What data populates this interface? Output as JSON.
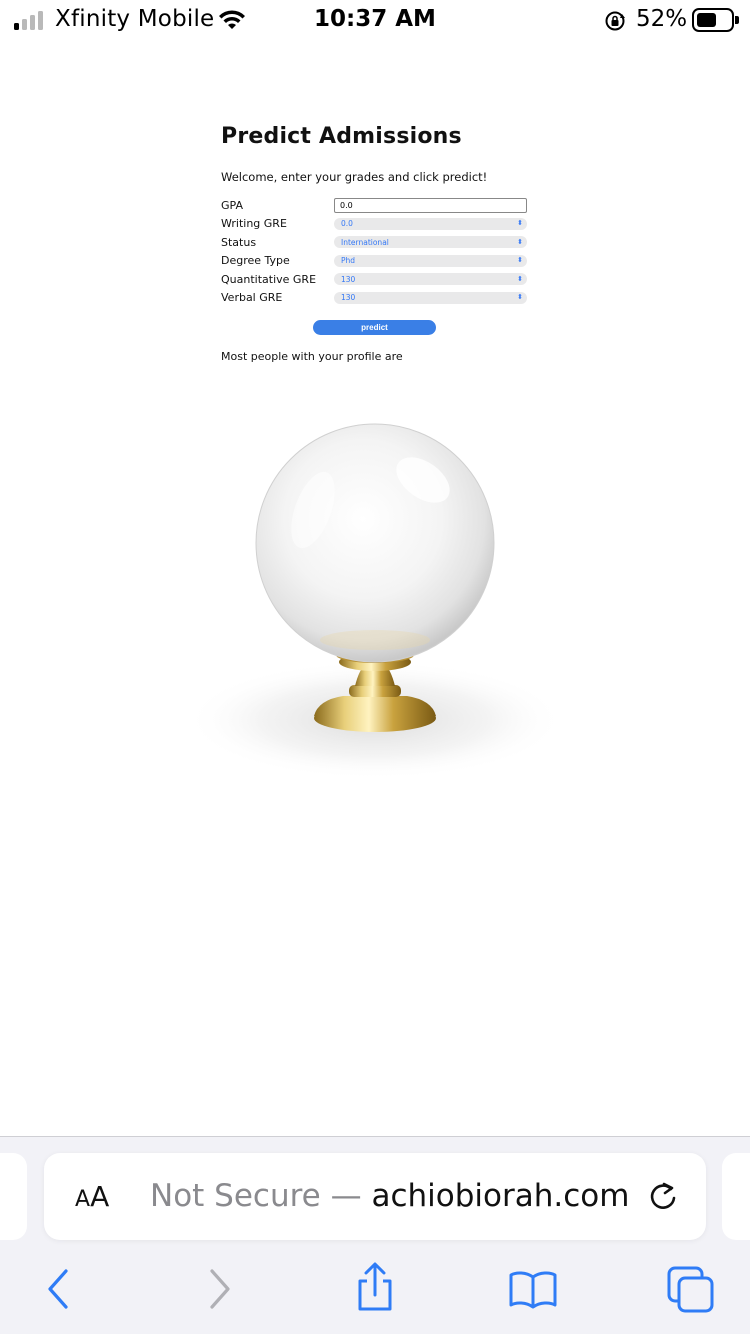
{
  "status_bar": {
    "carrier": "Xfinity Mobile",
    "time": "10:37 AM",
    "battery_percent": "52%",
    "battery_level": 0.52,
    "signal_bars_active": 1,
    "signal_bars_total": 4
  },
  "page": {
    "title": "Predict Admissions",
    "welcome": "Welcome, enter your grades and click predict!",
    "fields": {
      "gpa": {
        "label": "GPA",
        "value": "0.0"
      },
      "writing_gre": {
        "label": "Writing GRE",
        "value": "0.0"
      },
      "status": {
        "label": "Status",
        "value": "International"
      },
      "degree_type": {
        "label": "Degree Type",
        "value": "Phd"
      },
      "quantitative_gre": {
        "label": "Quantitative GRE",
        "value": "130"
      },
      "verbal_gre": {
        "label": "Verbal GRE",
        "value": "130"
      }
    },
    "predict_label": "predict",
    "result_text": "Most people with your profile are"
  },
  "browser": {
    "aa_label_large": "A",
    "aa_label_small": "A",
    "not_secure": "Not Secure —",
    "domain": "achiobiorah.com",
    "icons": [
      "reload-icon",
      "back-icon",
      "forward-icon",
      "share-icon",
      "bookmarks-icon",
      "tabs-icon"
    ]
  },
  "colors": {
    "accent": "#3a7fe6",
    "select_text": "#3478f6",
    "toolbar_blue": "#2f7cf6",
    "disabled": "#b0b0b5"
  }
}
